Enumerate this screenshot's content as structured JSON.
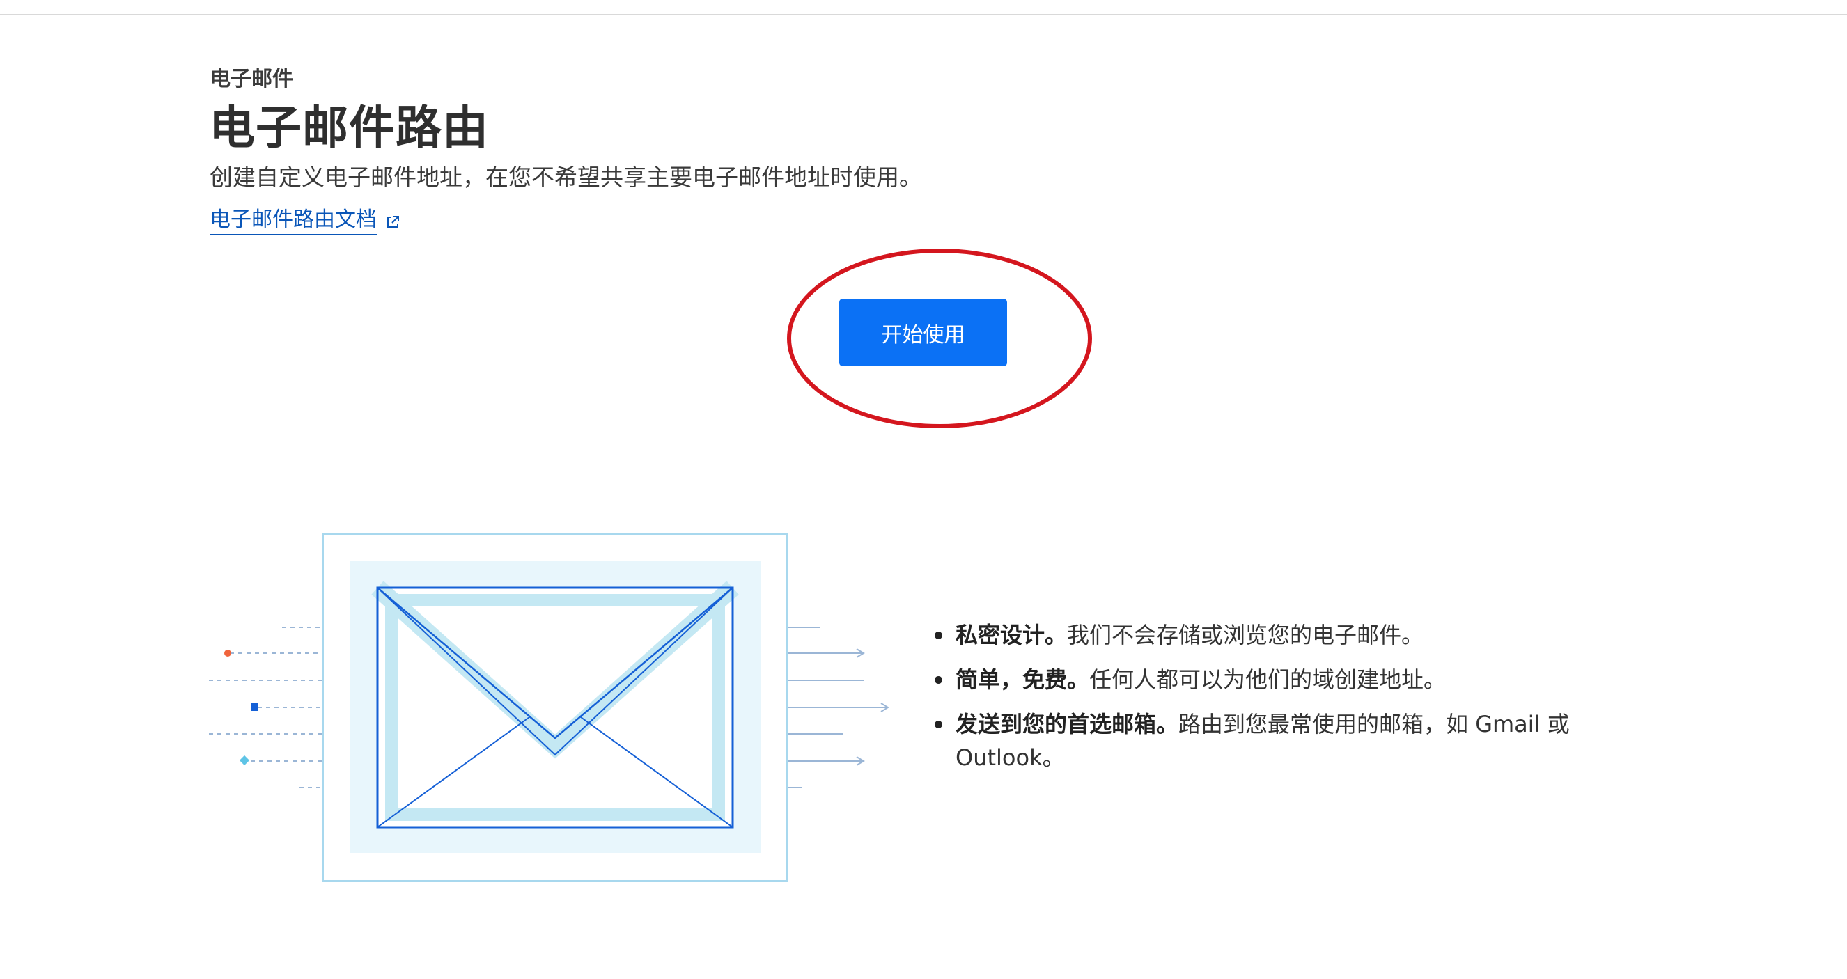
{
  "header": {
    "eyebrow": "电子邮件",
    "title": "电子邮件路由",
    "description": "创建自定义电子邮件地址，在您不希望共享主要电子邮件地址时使用。",
    "docs_link": "电子邮件路由文档",
    "docs_link_icon": "external-link-icon"
  },
  "cta": {
    "start_label": "开始使用",
    "button_color": "#0b71f5",
    "annotation_color": "#d4161e"
  },
  "illustration": {
    "icon": "envelope-icon",
    "accent_colors": [
      "#f0643c",
      "#1560d6",
      "#5ec4e6"
    ]
  },
  "features": [
    {
      "strong": "私密设计。",
      "text": "我们不会存储或浏览您的电子邮件。"
    },
    {
      "strong": "简单，免费。",
      "text": "任何人都可以为他们的域创建地址。"
    },
    {
      "strong": "发送到您的首选邮箱。",
      "text": "路由到您最常使用的邮箱，如 Gmail 或 Outlook。"
    }
  ]
}
